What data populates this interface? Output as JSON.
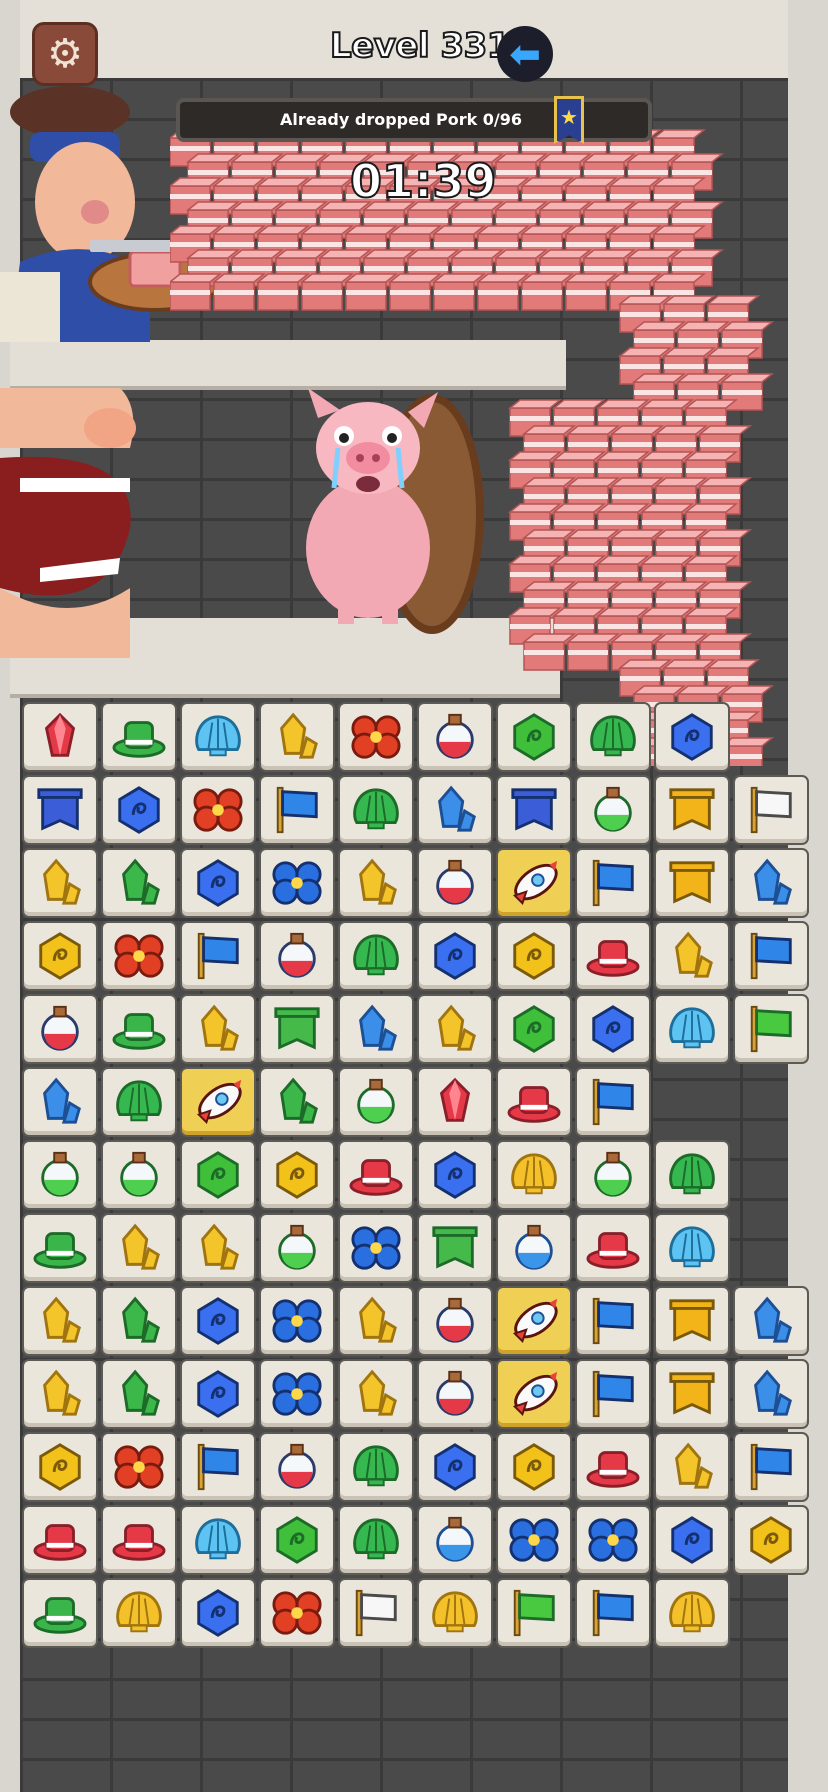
{
  "header": {
    "settings_icon": "gear-icon",
    "level_text": "Level 331",
    "back_icon": "arrow-left-icon",
    "back_icon_color": "#3aa7ff"
  },
  "progress": {
    "label": "Already dropped Pork  0/96",
    "dropped": 0,
    "total": 96,
    "fraction": 0.0,
    "badge_icon": "star-ribbon-icon"
  },
  "timer": {
    "text": "01:39"
  },
  "scene": {
    "characters": [
      "butcher",
      "giant-mouth",
      "crying-pig"
    ],
    "pork_icon": "pork-cube-icon"
  },
  "colors": {
    "tile_bg": "#ebe6dc",
    "tile_highlight": "#f0cf55",
    "red_gem": "#e53948",
    "green_hat": "#39b54a",
    "blue_shell": "#5cc3f2",
    "yellow_gem": "#f4c52a",
    "red_flower": "#e24025",
    "potion_red": "#e53948",
    "green_hex": "#3fbf3a",
    "green_shell": "#36b851",
    "blue_hex": "#3a6ff0",
    "blue_banner": "#3b5ed8",
    "blue_gem": "#3b8fe8",
    "blue_flag": "#2f86e8",
    "potion_green": "#4fcf4f",
    "yellow_banner": "#f2b418",
    "white_flag": "#f7f7f7",
    "green_gem": "#3cb84a",
    "blue_flower": "#2a6fe0",
    "red_hat": "#e53948",
    "yellow_hex": "#f2c21a",
    "green_flag": "#49c93f",
    "green_banner": "#45b94a",
    "yellow_shell": "#f5c12a",
    "potion_blue": "#3a96e8",
    "rocket": "#e8433a"
  },
  "board": {
    "rows": [
      [
        "red-gem",
        "green-hat",
        "blue-shell",
        "yellow-gem",
        "red-flower",
        "potion-red",
        "green-hex",
        "green-shell",
        "blue-hex"
      ],
      [
        "blue-banner",
        "blue-hex",
        "red-flower",
        "blue-flag",
        "green-shell",
        "blue-gem",
        "blue-banner",
        "potion-green",
        "yellow-banner",
        "white-flag"
      ],
      [
        "yellow-gem",
        "green-gem",
        "blue-hex",
        "blue-flower",
        "yellow-gem",
        "potion-red",
        "rocket",
        "blue-flag",
        "yellow-banner",
        "blue-gem"
      ],
      [
        "yellow-hex",
        "red-flower",
        "blue-flag",
        "potion-red",
        "green-shell",
        "blue-hex",
        "yellow-hex",
        "red-hat",
        "yellow-gem",
        "blue-flag"
      ],
      [
        "potion-red",
        "green-hat",
        "yellow-gem",
        "green-banner",
        "blue-gem",
        "yellow-gem",
        "green-hex",
        "blue-hex",
        "blue-shell",
        "green-flag"
      ],
      [
        "blue-gem",
        "green-shell",
        "rocket",
        "green-gem",
        "potion-green",
        "red-gem",
        "red-hat",
        "blue-flag"
      ],
      [
        "potion-green",
        "potion-green",
        "green-hex",
        "yellow-hex",
        "red-hat",
        "blue-hex",
        "yellow-shell",
        "potion-green",
        "green-shell"
      ],
      [
        "green-hat",
        "yellow-gem",
        "yellow-gem",
        "potion-green",
        "blue-flower",
        "green-banner",
        "potion-blue",
        "red-hat",
        "blue-shell"
      ],
      [
        "yellow-gem",
        "green-gem",
        "blue-hex",
        "blue-flower",
        "yellow-gem",
        "potion-red",
        "rocket",
        "blue-flag",
        "yellow-banner",
        "blue-gem"
      ],
      [
        "yellow-gem",
        "green-gem",
        "blue-hex",
        "blue-flower",
        "yellow-gem",
        "potion-red",
        "rocket",
        "blue-flag",
        "yellow-banner",
        "blue-gem"
      ],
      [
        "yellow-hex",
        "red-flower",
        "blue-flag",
        "potion-red",
        "green-shell",
        "blue-hex",
        "yellow-hex",
        "red-hat",
        "yellow-gem",
        "blue-flag"
      ],
      [
        "red-hat",
        "red-hat",
        "blue-shell",
        "green-hex",
        "green-shell",
        "potion-blue",
        "blue-flower",
        "blue-flower",
        "blue-hex",
        "yellow-hex"
      ],
      [
        "green-hat",
        "yellow-shell",
        "blue-hex",
        "red-flower",
        "white-flag",
        "yellow-shell",
        "green-flag",
        "blue-flag",
        "yellow-shell"
      ]
    ]
  }
}
